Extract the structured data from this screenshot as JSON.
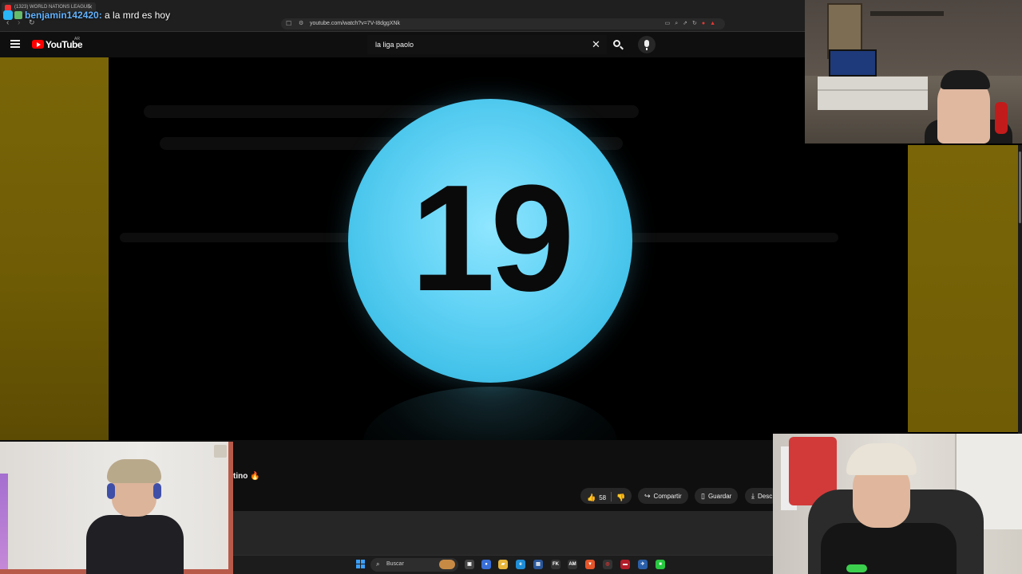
{
  "browser": {
    "tab_title": "(1323) WORLD NATIONS LEAGUE",
    "url": "youtube.com/watch?v=7V-I8dggXNk"
  },
  "chat": {
    "username": "benjamin142420:",
    "message": " a la mrd es hoy"
  },
  "youtube": {
    "logo_text": "YouTube",
    "country_code": "AR",
    "search_value": "la liga paolo"
  },
  "video": {
    "number": "19"
  },
  "below_video": {
    "title_fragment": "tino",
    "like_count": "58",
    "share_label": "Compartir",
    "save_label": "Guardar",
    "download_label": "Desc"
  },
  "taskbar": {
    "search_placeholder": "Buscar"
  },
  "colors": {
    "ball": "#63d3f5",
    "side_panels": "#7a6608",
    "youtube_red": "#ff0000"
  }
}
